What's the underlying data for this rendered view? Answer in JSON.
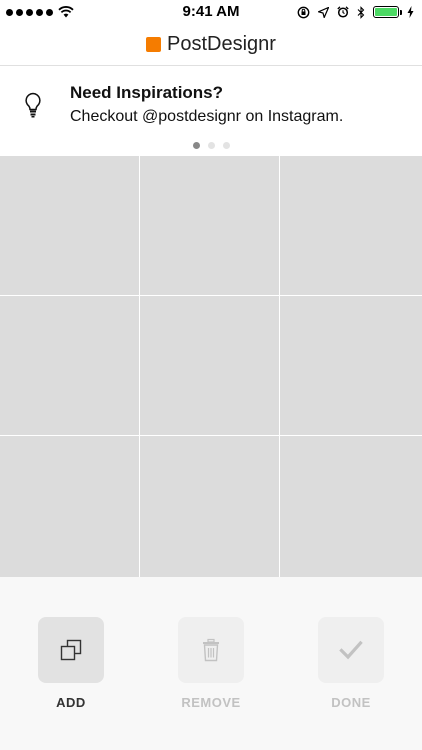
{
  "status_bar": {
    "time": "9:41 AM",
    "signal_dots": 5,
    "battery_percent": 100,
    "icons": [
      "wifi-icon",
      "orientation-lock-icon",
      "location-icon",
      "alarm-icon",
      "bluetooth-icon",
      "battery-icon",
      "charging-icon"
    ]
  },
  "navbar": {
    "app_title": "PostDesignr",
    "logo_color": "#f57c00"
  },
  "banner": {
    "icon": "lightbulb-icon",
    "title": "Need Inspirations?",
    "text": "Checkout @postdesignr on Instagram.",
    "page_count": 3,
    "active_page": 1
  },
  "grid": {
    "rows": 3,
    "columns": 3,
    "cell_color": "#dcdcdc"
  },
  "actions": {
    "add": {
      "label": "ADD",
      "icon": "copy-icon",
      "enabled": true
    },
    "remove": {
      "label": "REMOVE",
      "icon": "trash-icon",
      "enabled": false
    },
    "done": {
      "label": "DONE",
      "icon": "checkmark-icon",
      "enabled": false
    }
  }
}
